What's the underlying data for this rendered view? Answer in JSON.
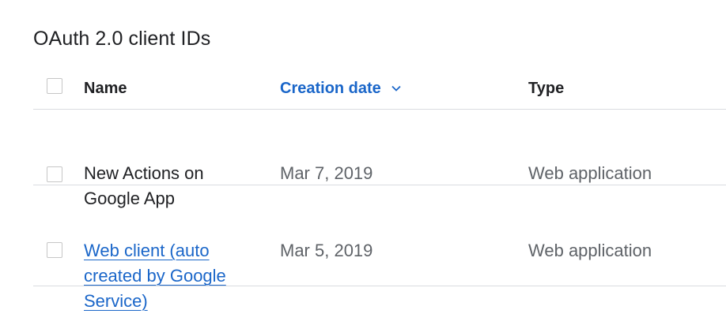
{
  "section": {
    "title": "OAuth 2.0 client IDs"
  },
  "table": {
    "columns": {
      "name": "Name",
      "creation_date": "Creation date",
      "type": "Type"
    },
    "sort": {
      "column": "creation_date",
      "direction": "descending",
      "icon": "chevron-down-icon"
    },
    "rows": [
      {
        "name": "New Actions on Google App",
        "creation_date": "Mar 7, 2019",
        "type": "Web application",
        "is_link": false
      },
      {
        "name": "Web client (auto created by Google Service)",
        "creation_date": "Mar 5, 2019",
        "type": "Web application",
        "is_link": true
      }
    ]
  },
  "colors": {
    "link": "#1a66c9",
    "text": "#202124",
    "muted": "#5f6368",
    "divider": "#dadce0"
  }
}
